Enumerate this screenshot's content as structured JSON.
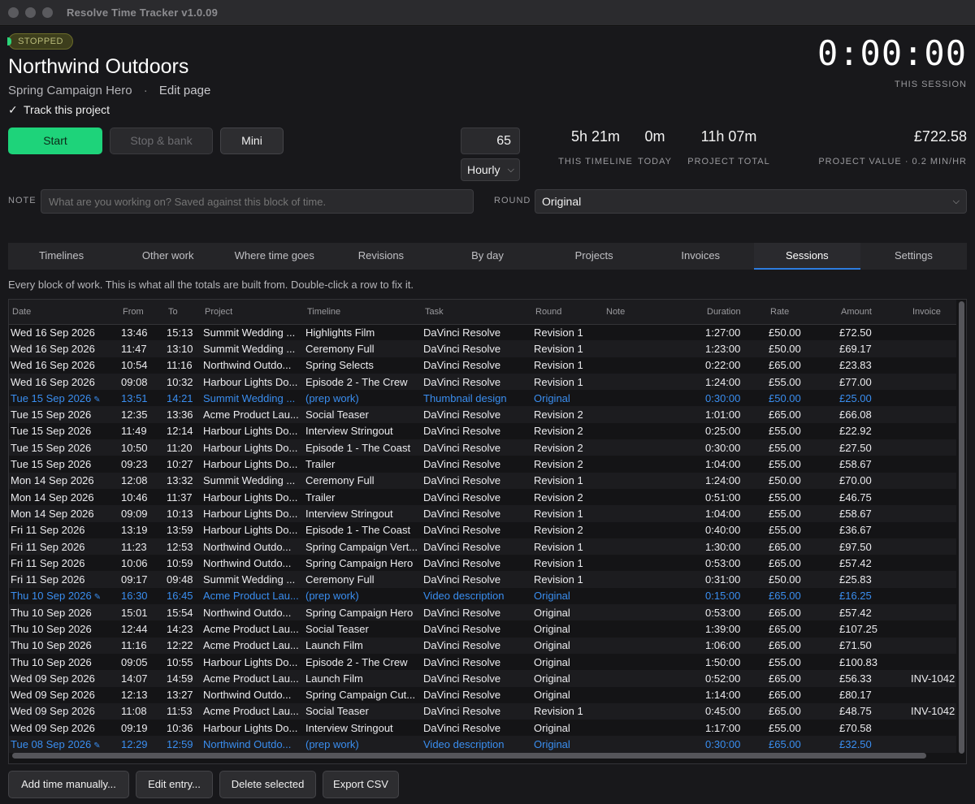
{
  "window": {
    "title": "Resolve Time Tracker  v1.0.09"
  },
  "header": {
    "status": "STOPPED",
    "project_name": "Northwind Outdoors",
    "timeline_name": "Spring Campaign Hero",
    "separator": "·",
    "edit_page": "Edit page",
    "track_checked": "✓",
    "track_label": "Track this project",
    "timer": "0:00:00",
    "timer_label": "THIS SESSION"
  },
  "controls": {
    "start": "Start",
    "stop": "Stop & bank",
    "mini": "Mini",
    "rate_value": "65",
    "rate_type": "Hourly"
  },
  "stats": {
    "this_timeline": {
      "value": "5h 21m",
      "label": "THIS TIMELINE"
    },
    "today": {
      "value": "0m",
      "label": "TODAY"
    },
    "project_total": {
      "value": "11h 07m",
      "label": "PROJECT TOTAL"
    },
    "project_value": {
      "value": "£722.58",
      "label": "PROJECT VALUE · 0.2 MIN/HR"
    }
  },
  "note": {
    "label": "NOTE",
    "placeholder": "What are you working on? Saved against this block of time."
  },
  "round": {
    "label": "ROUND",
    "value": "Original"
  },
  "tabs": [
    "Timelines",
    "Other work",
    "Where time goes",
    "Revisions",
    "By day",
    "Projects",
    "Invoices",
    "Sessions",
    "Settings"
  ],
  "active_tab": "Sessions",
  "hint": "Every block of work. This is what all the totals are built from. Double-click a row to fix it.",
  "table": {
    "columns": [
      "Date",
      "From",
      "To",
      "Project",
      "Timeline",
      "Task",
      "Round",
      "Note",
      "Duration",
      "Rate",
      "Amount",
      "Invoice"
    ],
    "rows": [
      {
        "date": "Wed 16 Sep 2026",
        "from": "13:46",
        "to": "15:13",
        "project": "Summit Wedding ...",
        "timeline": "Highlights Film",
        "task": "DaVinci Resolve",
        "round": "Revision 1",
        "note": "",
        "duration": "1:27:00",
        "rate": "£50.00",
        "amount": "£72.50",
        "invoice": "",
        "manual": false
      },
      {
        "date": "Wed 16 Sep 2026",
        "from": "11:47",
        "to": "13:10",
        "project": "Summit Wedding ...",
        "timeline": "Ceremony Full",
        "task": "DaVinci Resolve",
        "round": "Revision 1",
        "note": "",
        "duration": "1:23:00",
        "rate": "£50.00",
        "amount": "£69.17",
        "invoice": "",
        "manual": false
      },
      {
        "date": "Wed 16 Sep 2026",
        "from": "10:54",
        "to": "11:16",
        "project": "Northwind Outdo...",
        "timeline": "Spring Selects",
        "task": "DaVinci Resolve",
        "round": "Revision 1",
        "note": "",
        "duration": "0:22:00",
        "rate": "£65.00",
        "amount": "£23.83",
        "invoice": "",
        "manual": false
      },
      {
        "date": "Wed 16 Sep 2026",
        "from": "09:08",
        "to": "10:32",
        "project": "Harbour Lights Do...",
        "timeline": "Episode 2 - The Crew",
        "task": "DaVinci Resolve",
        "round": "Revision 1",
        "note": "",
        "duration": "1:24:00",
        "rate": "£55.00",
        "amount": "£77.00",
        "invoice": "",
        "manual": false
      },
      {
        "date": "Tue 15 Sep 2026",
        "from": "13:51",
        "to": "14:21",
        "project": "Summit Wedding ...",
        "timeline": "(prep work)",
        "task": "Thumbnail design",
        "round": "Original",
        "note": "",
        "duration": "0:30:00",
        "rate": "£50.00",
        "amount": "£25.00",
        "invoice": "",
        "manual": true
      },
      {
        "date": "Tue 15 Sep 2026",
        "from": "12:35",
        "to": "13:36",
        "project": "Acme Product Lau...",
        "timeline": "Social Teaser",
        "task": "DaVinci Resolve",
        "round": "Revision 2",
        "note": "",
        "duration": "1:01:00",
        "rate": "£65.00",
        "amount": "£66.08",
        "invoice": "",
        "manual": false
      },
      {
        "date": "Tue 15 Sep 2026",
        "from": "11:49",
        "to": "12:14",
        "project": "Harbour Lights Do...",
        "timeline": "Interview Stringout",
        "task": "DaVinci Resolve",
        "round": "Revision 2",
        "note": "",
        "duration": "0:25:00",
        "rate": "£55.00",
        "amount": "£22.92",
        "invoice": "",
        "manual": false
      },
      {
        "date": "Tue 15 Sep 2026",
        "from": "10:50",
        "to": "11:20",
        "project": "Harbour Lights Do...",
        "timeline": "Episode 1 - The Coast",
        "task": "DaVinci Resolve",
        "round": "Revision 2",
        "note": "",
        "duration": "0:30:00",
        "rate": "£55.00",
        "amount": "£27.50",
        "invoice": "",
        "manual": false
      },
      {
        "date": "Tue 15 Sep 2026",
        "from": "09:23",
        "to": "10:27",
        "project": "Harbour Lights Do...",
        "timeline": "Trailer",
        "task": "DaVinci Resolve",
        "round": "Revision 2",
        "note": "",
        "duration": "1:04:00",
        "rate": "£55.00",
        "amount": "£58.67",
        "invoice": "",
        "manual": false
      },
      {
        "date": "Mon 14 Sep 2026",
        "from": "12:08",
        "to": "13:32",
        "project": "Summit Wedding ...",
        "timeline": "Ceremony Full",
        "task": "DaVinci Resolve",
        "round": "Revision 1",
        "note": "",
        "duration": "1:24:00",
        "rate": "£50.00",
        "amount": "£70.00",
        "invoice": "",
        "manual": false
      },
      {
        "date": "Mon 14 Sep 2026",
        "from": "10:46",
        "to": "11:37",
        "project": "Harbour Lights Do...",
        "timeline": "Trailer",
        "task": "DaVinci Resolve",
        "round": "Revision 2",
        "note": "",
        "duration": "0:51:00",
        "rate": "£55.00",
        "amount": "£46.75",
        "invoice": "",
        "manual": false
      },
      {
        "date": "Mon 14 Sep 2026",
        "from": "09:09",
        "to": "10:13",
        "project": "Harbour Lights Do...",
        "timeline": "Interview Stringout",
        "task": "DaVinci Resolve",
        "round": "Revision 1",
        "note": "",
        "duration": "1:04:00",
        "rate": "£55.00",
        "amount": "£58.67",
        "invoice": "",
        "manual": false
      },
      {
        "date": "Fri 11 Sep 2026",
        "from": "13:19",
        "to": "13:59",
        "project": "Harbour Lights Do...",
        "timeline": "Episode 1 - The Coast",
        "task": "DaVinci Resolve",
        "round": "Revision 2",
        "note": "",
        "duration": "0:40:00",
        "rate": "£55.00",
        "amount": "£36.67",
        "invoice": "",
        "manual": false
      },
      {
        "date": "Fri 11 Sep 2026",
        "from": "11:23",
        "to": "12:53",
        "project": "Northwind Outdo...",
        "timeline": "Spring Campaign Vert...",
        "task": "DaVinci Resolve",
        "round": "Revision 1",
        "note": "",
        "duration": "1:30:00",
        "rate": "£65.00",
        "amount": "£97.50",
        "invoice": "",
        "manual": false
      },
      {
        "date": "Fri 11 Sep 2026",
        "from": "10:06",
        "to": "10:59",
        "project": "Northwind Outdo...",
        "timeline": "Spring Campaign Hero",
        "task": "DaVinci Resolve",
        "round": "Revision 1",
        "note": "",
        "duration": "0:53:00",
        "rate": "£65.00",
        "amount": "£57.42",
        "invoice": "",
        "manual": false
      },
      {
        "date": "Fri 11 Sep 2026",
        "from": "09:17",
        "to": "09:48",
        "project": "Summit Wedding ...",
        "timeline": "Ceremony Full",
        "task": "DaVinci Resolve",
        "round": "Revision 1",
        "note": "",
        "duration": "0:31:00",
        "rate": "£50.00",
        "amount": "£25.83",
        "invoice": "",
        "manual": false
      },
      {
        "date": "Thu 10 Sep 2026",
        "from": "16:30",
        "to": "16:45",
        "project": "Acme Product Lau...",
        "timeline": "(prep work)",
        "task": "Video description",
        "round": "Original",
        "note": "",
        "duration": "0:15:00",
        "rate": "£65.00",
        "amount": "£16.25",
        "invoice": "",
        "manual": true
      },
      {
        "date": "Thu 10 Sep 2026",
        "from": "15:01",
        "to": "15:54",
        "project": "Northwind Outdo...",
        "timeline": "Spring Campaign Hero",
        "task": "DaVinci Resolve",
        "round": "Original",
        "note": "",
        "duration": "0:53:00",
        "rate": "£65.00",
        "amount": "£57.42",
        "invoice": "",
        "manual": false
      },
      {
        "date": "Thu 10 Sep 2026",
        "from": "12:44",
        "to": "14:23",
        "project": "Acme Product Lau...",
        "timeline": "Social Teaser",
        "task": "DaVinci Resolve",
        "round": "Original",
        "note": "",
        "duration": "1:39:00",
        "rate": "£65.00",
        "amount": "£107.25",
        "invoice": "",
        "manual": false
      },
      {
        "date": "Thu 10 Sep 2026",
        "from": "11:16",
        "to": "12:22",
        "project": "Acme Product Lau...",
        "timeline": "Launch Film",
        "task": "DaVinci Resolve",
        "round": "Original",
        "note": "",
        "duration": "1:06:00",
        "rate": "£65.00",
        "amount": "£71.50",
        "invoice": "",
        "manual": false
      },
      {
        "date": "Thu 10 Sep 2026",
        "from": "09:05",
        "to": "10:55",
        "project": "Harbour Lights Do...",
        "timeline": "Episode 2 - The Crew",
        "task": "DaVinci Resolve",
        "round": "Original",
        "note": "",
        "duration": "1:50:00",
        "rate": "£55.00",
        "amount": "£100.83",
        "invoice": "",
        "manual": false
      },
      {
        "date": "Wed 09 Sep 2026",
        "from": "14:07",
        "to": "14:59",
        "project": "Acme Product Lau...",
        "timeline": "Launch Film",
        "task": "DaVinci Resolve",
        "round": "Original",
        "note": "",
        "duration": "0:52:00",
        "rate": "£65.00",
        "amount": "£56.33",
        "invoice": "INV-1042",
        "manual": false
      },
      {
        "date": "Wed 09 Sep 2026",
        "from": "12:13",
        "to": "13:27",
        "project": "Northwind Outdo...",
        "timeline": "Spring Campaign Cut...",
        "task": "DaVinci Resolve",
        "round": "Original",
        "note": "",
        "duration": "1:14:00",
        "rate": "£65.00",
        "amount": "£80.17",
        "invoice": "",
        "manual": false
      },
      {
        "date": "Wed 09 Sep 2026",
        "from": "11:08",
        "to": "11:53",
        "project": "Acme Product Lau...",
        "timeline": "Social Teaser",
        "task": "DaVinci Resolve",
        "round": "Revision 1",
        "note": "",
        "duration": "0:45:00",
        "rate": "£65.00",
        "amount": "£48.75",
        "invoice": "INV-1042",
        "manual": false
      },
      {
        "date": "Wed 09 Sep 2026",
        "from": "09:19",
        "to": "10:36",
        "project": "Harbour Lights Do...",
        "timeline": "Interview Stringout",
        "task": "DaVinci Resolve",
        "round": "Original",
        "note": "",
        "duration": "1:17:00",
        "rate": "£55.00",
        "amount": "£70.58",
        "invoice": "",
        "manual": false
      },
      {
        "date": "Tue 08 Sep 2026",
        "from": "12:29",
        "to": "12:59",
        "project": "Northwind Outdo...",
        "timeline": "(prep work)",
        "task": "Video description",
        "round": "Original",
        "note": "",
        "duration": "0:30:00",
        "rate": "£65.00",
        "amount": "£32.50",
        "invoice": "",
        "manual": true
      }
    ]
  },
  "pencil_glyph": "✎",
  "bottom_buttons": [
    "Add time manually...",
    "Edit entry...",
    "Delete selected",
    "Export CSV"
  ]
}
